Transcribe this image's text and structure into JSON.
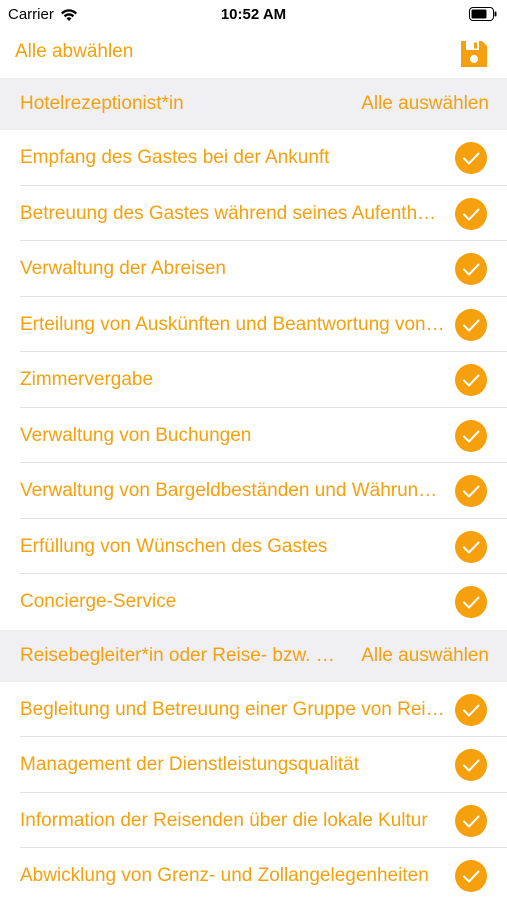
{
  "status_bar": {
    "carrier": "Carrier",
    "time": "10:52 AM"
  },
  "nav": {
    "deselect_all": "Alle abwählen",
    "save_icon": "save-icon"
  },
  "accent_color": "#f5a00c",
  "sections": [
    {
      "title": "Hotelrezeptionist*in",
      "action": "Alle auswählen",
      "items": [
        {
          "label": "Empfang des Gastes bei der Ankunft",
          "checked": true
        },
        {
          "label": "Betreuung des Gastes während seines Aufenthalts",
          "checked": true
        },
        {
          "label": "Verwaltung der Abreisen",
          "checked": true
        },
        {
          "label": "Erteilung von Auskünften und Beantwortung von Anfragen",
          "checked": true
        },
        {
          "label": "Zimmervergabe",
          "checked": true
        },
        {
          "label": "Verwaltung von Buchungen",
          "checked": true
        },
        {
          "label": "Verwaltung von Bargeldbeständen und Währungen",
          "checked": true
        },
        {
          "label": "Erfüllung von Wünschen des Gastes",
          "checked": true
        },
        {
          "label": "Concierge-Service",
          "checked": true
        }
      ]
    },
    {
      "title": "Reisebegleiter*in oder Reise- bzw. Gästeführer*in",
      "action": "Alle auswählen",
      "items": [
        {
          "label": "Begleitung und Betreuung einer Gruppe von Reisenden",
          "checked": true
        },
        {
          "label": "Management der Dienstleistungsqualität",
          "checked": true
        },
        {
          "label": "Information der Reisenden über die lokale Kultur",
          "checked": true
        },
        {
          "label": "Abwicklung von Grenz- und Zollangelegenheiten",
          "checked": true
        }
      ]
    }
  ]
}
